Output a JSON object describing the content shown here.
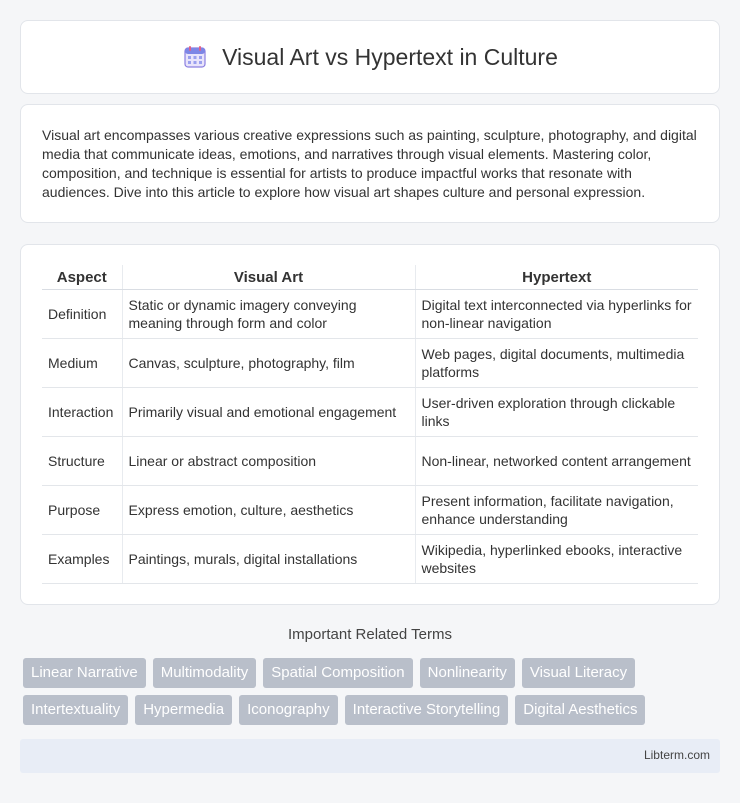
{
  "header": {
    "title": "Visual Art vs Hypertext in Culture",
    "icon": "calendar-icon"
  },
  "intro": {
    "text": "Visual art encompasses various creative expressions such as painting, sculpture, photography, and digital media that communicate ideas, emotions, and narratives through visual elements. Mastering color, composition, and technique is essential for artists to produce impactful works that resonate with audiences. Dive into this article to explore how visual art shapes culture and personal expression."
  },
  "table": {
    "headers": [
      "Aspect",
      "Visual Art",
      "Hypertext"
    ],
    "rows": [
      [
        "Definition",
        "Static or dynamic imagery conveying meaning through form and color",
        "Digital text interconnected via hyperlinks for non-linear navigation"
      ],
      [
        "Medium",
        "Canvas, sculpture, photography, film",
        "Web pages, digital documents, multimedia platforms"
      ],
      [
        "Interaction",
        "Primarily visual and emotional engagement",
        "User-driven exploration through clickable links"
      ],
      [
        "Structure",
        "Linear or abstract composition",
        "Non-linear, networked content arrangement"
      ],
      [
        "Purpose",
        "Express emotion, culture, aesthetics",
        "Present information, facilitate navigation, enhance understanding"
      ],
      [
        "Examples",
        "Paintings, murals, digital installations",
        "Wikipedia, hyperlinked ebooks, interactive websites"
      ]
    ]
  },
  "related": {
    "title": "Important Related Terms",
    "tags": [
      "Linear Narrative",
      "Multimodality",
      "Spatial Composition",
      "Nonlinearity",
      "Visual Literacy",
      "Intertextuality",
      "Hypermedia",
      "Iconography",
      "Interactive Storytelling",
      "Digital Aesthetics"
    ]
  },
  "footer": {
    "text": "Libterm.com"
  },
  "colors": {
    "tag_bg": "#b9bfca",
    "footer_bg": "#e8edf6",
    "icon_accent": "#5b6bd6"
  }
}
